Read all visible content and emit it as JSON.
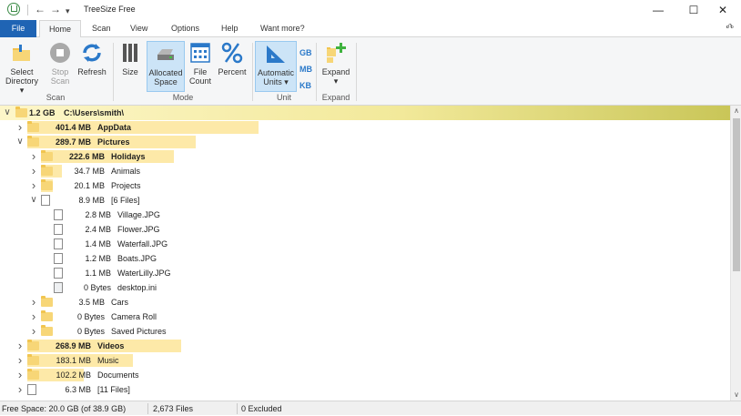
{
  "window": {
    "title": "TreeSize Free",
    "minimize_glyph": "—",
    "maximize_glyph": "☐",
    "close_glyph": "✕"
  },
  "quick_access": {
    "back_glyph": "←",
    "forward_glyph": "→",
    "customize_glyph": "▾"
  },
  "tabs": {
    "file": "File",
    "home": "Home",
    "scan": "Scan",
    "view": "View",
    "options": "Options",
    "help": "Help",
    "want_more": "Want more?",
    "collapse_glyph": "Ⰴ"
  },
  "ribbon": {
    "select_directory": [
      "Select",
      "Directory ▾"
    ],
    "stop_scan": [
      "Stop",
      "Scan"
    ],
    "refresh": "Refresh",
    "group_scan": "Scan",
    "size": "Size",
    "allocated_space": [
      "Allocated",
      "Space"
    ],
    "file_count": [
      "File",
      "Count"
    ],
    "percent": "Percent",
    "group_mode": "Mode",
    "automatic_units": [
      "Automatic",
      "Units ▾"
    ],
    "unit_gb": "GB",
    "unit_mb": "MB",
    "unit_kb": "KB",
    "group_unit": "Unit",
    "expand": [
      "Expand",
      "▾"
    ],
    "group_expand": "Expand"
  },
  "tree": {
    "root": {
      "size": "1.2 GB",
      "name": "C:\\Users\\smith\\"
    },
    "rows": [
      {
        "size": "401.4 MB",
        "name": "AppData",
        "bold": true,
        "level": 1,
        "icon": "folder",
        "expander": ">",
        "bar_fraction": 0.33
      },
      {
        "size": "289.7 MB",
        "name": "Pictures",
        "bold": true,
        "level": 1,
        "icon": "folder",
        "expander": "v",
        "bar_fraction": 0.24
      },
      {
        "size": "222.6 MB",
        "name": "Holidays",
        "bold": true,
        "level": 2,
        "icon": "folder",
        "expander": ">",
        "bar_fraction": 0.77
      },
      {
        "size": "34.7 MB",
        "name": "Animals",
        "bold": false,
        "level": 2,
        "icon": "folder",
        "expander": ">",
        "bar_fraction": 0.12
      },
      {
        "size": "20.1 MB",
        "name": "Projects",
        "bold": false,
        "level": 2,
        "icon": "folder",
        "expander": ">",
        "bar_fraction": 0.07
      },
      {
        "size": "8.9 MB",
        "name": "[6 Files]",
        "bold": false,
        "level": 2,
        "icon": "file",
        "expander": "v",
        "bar_fraction": 0.0
      },
      {
        "size": "2.8 MB",
        "name": "Village.JPG",
        "bold": false,
        "level": 3,
        "icon": "file",
        "expander": "",
        "bar_fraction": 0.0
      },
      {
        "size": "2.4 MB",
        "name": "Flower.JPG",
        "bold": false,
        "level": 3,
        "icon": "file",
        "expander": "",
        "bar_fraction": 0.0
      },
      {
        "size": "1.4 MB",
        "name": "Waterfall.JPG",
        "bold": false,
        "level": 3,
        "icon": "file",
        "expander": "",
        "bar_fraction": 0.0
      },
      {
        "size": "1.2 MB",
        "name": "Boats.JPG",
        "bold": false,
        "level": 3,
        "icon": "file",
        "expander": "",
        "bar_fraction": 0.0
      },
      {
        "size": "1.1 MB",
        "name": "WaterLilly.JPG",
        "bold": false,
        "level": 3,
        "icon": "file",
        "expander": "",
        "bar_fraction": 0.0
      },
      {
        "size": "0 Bytes",
        "name": "desktop.ini",
        "bold": false,
        "level": 3,
        "icon": "ini",
        "expander": "",
        "bar_fraction": 0.0
      },
      {
        "size": "3.5 MB",
        "name": "Cars",
        "bold": false,
        "level": 2,
        "icon": "folder",
        "expander": ">",
        "bar_fraction": 0.0
      },
      {
        "size": "0 Bytes",
        "name": "Camera Roll",
        "bold": false,
        "level": 2,
        "icon": "folder",
        "expander": ">",
        "bar_fraction": 0.0
      },
      {
        "size": "0 Bytes",
        "name": "Saved Pictures",
        "bold": false,
        "level": 2,
        "icon": "folder",
        "expander": ">",
        "bar_fraction": 0.0
      },
      {
        "size": "268.9 MB",
        "name": "Videos",
        "bold": true,
        "level": 1,
        "icon": "folder",
        "expander": ">",
        "bar_fraction": 0.22
      },
      {
        "size": "183.1 MB",
        "name": "Music",
        "bold": false,
        "level": 1,
        "icon": "folder",
        "expander": ">",
        "bar_fraction": 0.15
      },
      {
        "size": "102.2 MB",
        "name": "Documents",
        "bold": false,
        "level": 1,
        "icon": "folder",
        "expander": ">",
        "bar_fraction": 0.08
      },
      {
        "size": "6.3 MB",
        "name": "[11 Files]",
        "bold": false,
        "level": 1,
        "icon": "file",
        "expander": ">",
        "bar_fraction": 0.0
      }
    ]
  },
  "status": {
    "free_space": "Free Space: 20.0 GB  (of 38.9 GB)",
    "files": "2,673 Files",
    "excluded": "0 Excluded"
  },
  "colors": {
    "file_tab": "#1f64b4",
    "bar": "#fde9a8",
    "folder": "#f7d677",
    "pressed": "#cce4f7"
  }
}
